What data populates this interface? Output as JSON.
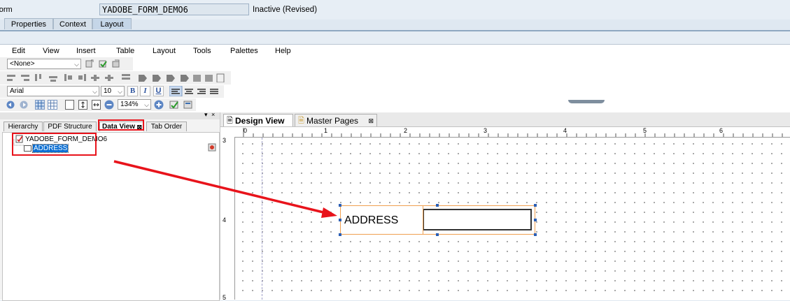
{
  "header": {
    "label": "Form",
    "form_name": "YADOBE_FORM_DEMO6",
    "status": "Inactive (Revised)"
  },
  "main_tabs": [
    {
      "label": "Properties",
      "active": false
    },
    {
      "label": "Context",
      "active": false
    },
    {
      "label": "Layout",
      "active": true
    }
  ],
  "menu": [
    "Edit",
    "View",
    "Insert",
    "Table",
    "Layout",
    "Tools",
    "Palettes",
    "Help"
  ],
  "toolbar": {
    "style_select": "<None>",
    "font_select": "Arial",
    "size_select": "10",
    "bold": "B",
    "italic": "I",
    "underline": "U",
    "zoom_select": "134%"
  },
  "left_tabs": [
    {
      "label": "Hierarchy",
      "active": false
    },
    {
      "label": "PDF Structure",
      "active": false
    },
    {
      "label": "Data View",
      "active": true,
      "highlighted": true
    },
    {
      "label": "Tab Order",
      "active": false
    }
  ],
  "data_tree": {
    "root": "YADOBE_FORM_DEMO6",
    "child": "ADDRESS"
  },
  "design_tabs": [
    {
      "label": "Design View",
      "active": true
    },
    {
      "label": "Master Pages",
      "active": false
    }
  ],
  "ruler": {
    "h_marks": [
      "0",
      "1",
      "2",
      "3",
      "4",
      "5",
      "6"
    ],
    "v_marks": [
      "3",
      "4",
      "5"
    ]
  },
  "canvas_field": {
    "caption": "ADDRESS"
  },
  "colors": {
    "highlight_red": "#e8131b",
    "selection_orange": "#f0a050",
    "tree_selection": "#0b6fd3"
  }
}
